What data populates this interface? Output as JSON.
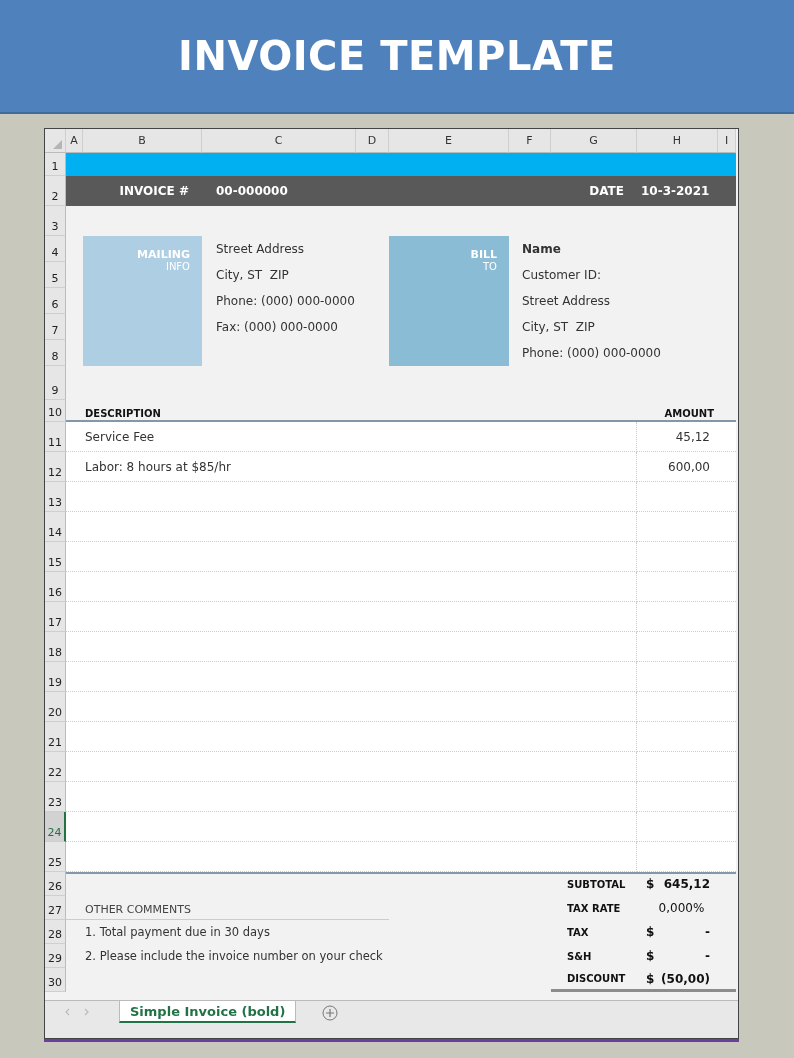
{
  "banner": {
    "title": "INVOICE TEMPLATE"
  },
  "sheet": {
    "column_headers": [
      "A",
      "B",
      "C",
      "D",
      "E",
      "F",
      "G",
      "H",
      "I"
    ],
    "row_headers": [
      {
        "label": "1",
        "selected": false
      },
      {
        "label": "2",
        "selected": false
      },
      {
        "label": "3",
        "selected": false
      },
      {
        "label": "4",
        "selected": false
      },
      {
        "label": "5",
        "selected": false
      },
      {
        "label": "6",
        "selected": false
      },
      {
        "label": "7",
        "selected": false
      },
      {
        "label": "8",
        "selected": false
      },
      {
        "label": "9",
        "selected": false
      },
      {
        "label": "10",
        "selected": false
      },
      {
        "label": "11",
        "selected": false
      },
      {
        "label": "12",
        "selected": false
      },
      {
        "label": "13",
        "selected": false
      },
      {
        "label": "14",
        "selected": false
      },
      {
        "label": "15",
        "selected": false
      },
      {
        "label": "16",
        "selected": false
      },
      {
        "label": "17",
        "selected": false
      },
      {
        "label": "18",
        "selected": false
      },
      {
        "label": "19",
        "selected": false
      },
      {
        "label": "20",
        "selected": false
      },
      {
        "label": "21",
        "selected": false
      },
      {
        "label": "22",
        "selected": false
      },
      {
        "label": "23",
        "selected": false
      },
      {
        "label": "24",
        "selected": true
      },
      {
        "label": "25",
        "selected": false
      },
      {
        "label": "26",
        "selected": false
      },
      {
        "label": "27",
        "selected": false
      },
      {
        "label": "28",
        "selected": false
      },
      {
        "label": "29",
        "selected": false
      },
      {
        "label": "30",
        "selected": false
      }
    ]
  },
  "header_bar": {
    "invoice_label": "INVOICE #",
    "invoice_number": "00-000000",
    "date_label": "DATE",
    "date": "10-3-2021"
  },
  "mailing": {
    "label": "MAILING",
    "sublabel": "INFO",
    "lines": [
      "Street Address",
      "City, ST  ZIP",
      "Phone: (000) 000-0000",
      "Fax: (000) 000-0000"
    ]
  },
  "bill_to": {
    "label": "BILL",
    "sublabel": "TO",
    "name": "Name",
    "lines": [
      "Customer ID:",
      "Street Address",
      "City, ST  ZIP",
      "Phone: (000) 000-0000"
    ]
  },
  "items": {
    "description_header": "DESCRIPTION",
    "amount_header": "AMOUNT",
    "rows": [
      {
        "description": "Service Fee",
        "amount": "45,12"
      },
      {
        "description": "Labor: 8 hours at $85/hr",
        "amount": "600,00"
      }
    ]
  },
  "comments": {
    "title": "OTHER COMMENTS",
    "lines": [
      "1. Total payment due in 30 days",
      "2. Please include the invoice number on your check"
    ]
  },
  "totals": [
    {
      "label": "SUBTOTAL",
      "currency": "$",
      "value": "645,12"
    },
    {
      "label": "TAX RATE",
      "value": "0,000%"
    },
    {
      "label": "TAX",
      "currency": "$",
      "value": "-"
    },
    {
      "label": "S&H",
      "currency": "$",
      "value": "-"
    },
    {
      "label": "DISCOUNT",
      "currency": "$",
      "value": "(50,00)"
    }
  ],
  "tabs": [
    {
      "label": "Simple Invoice (bold)",
      "selected": true
    }
  ]
}
